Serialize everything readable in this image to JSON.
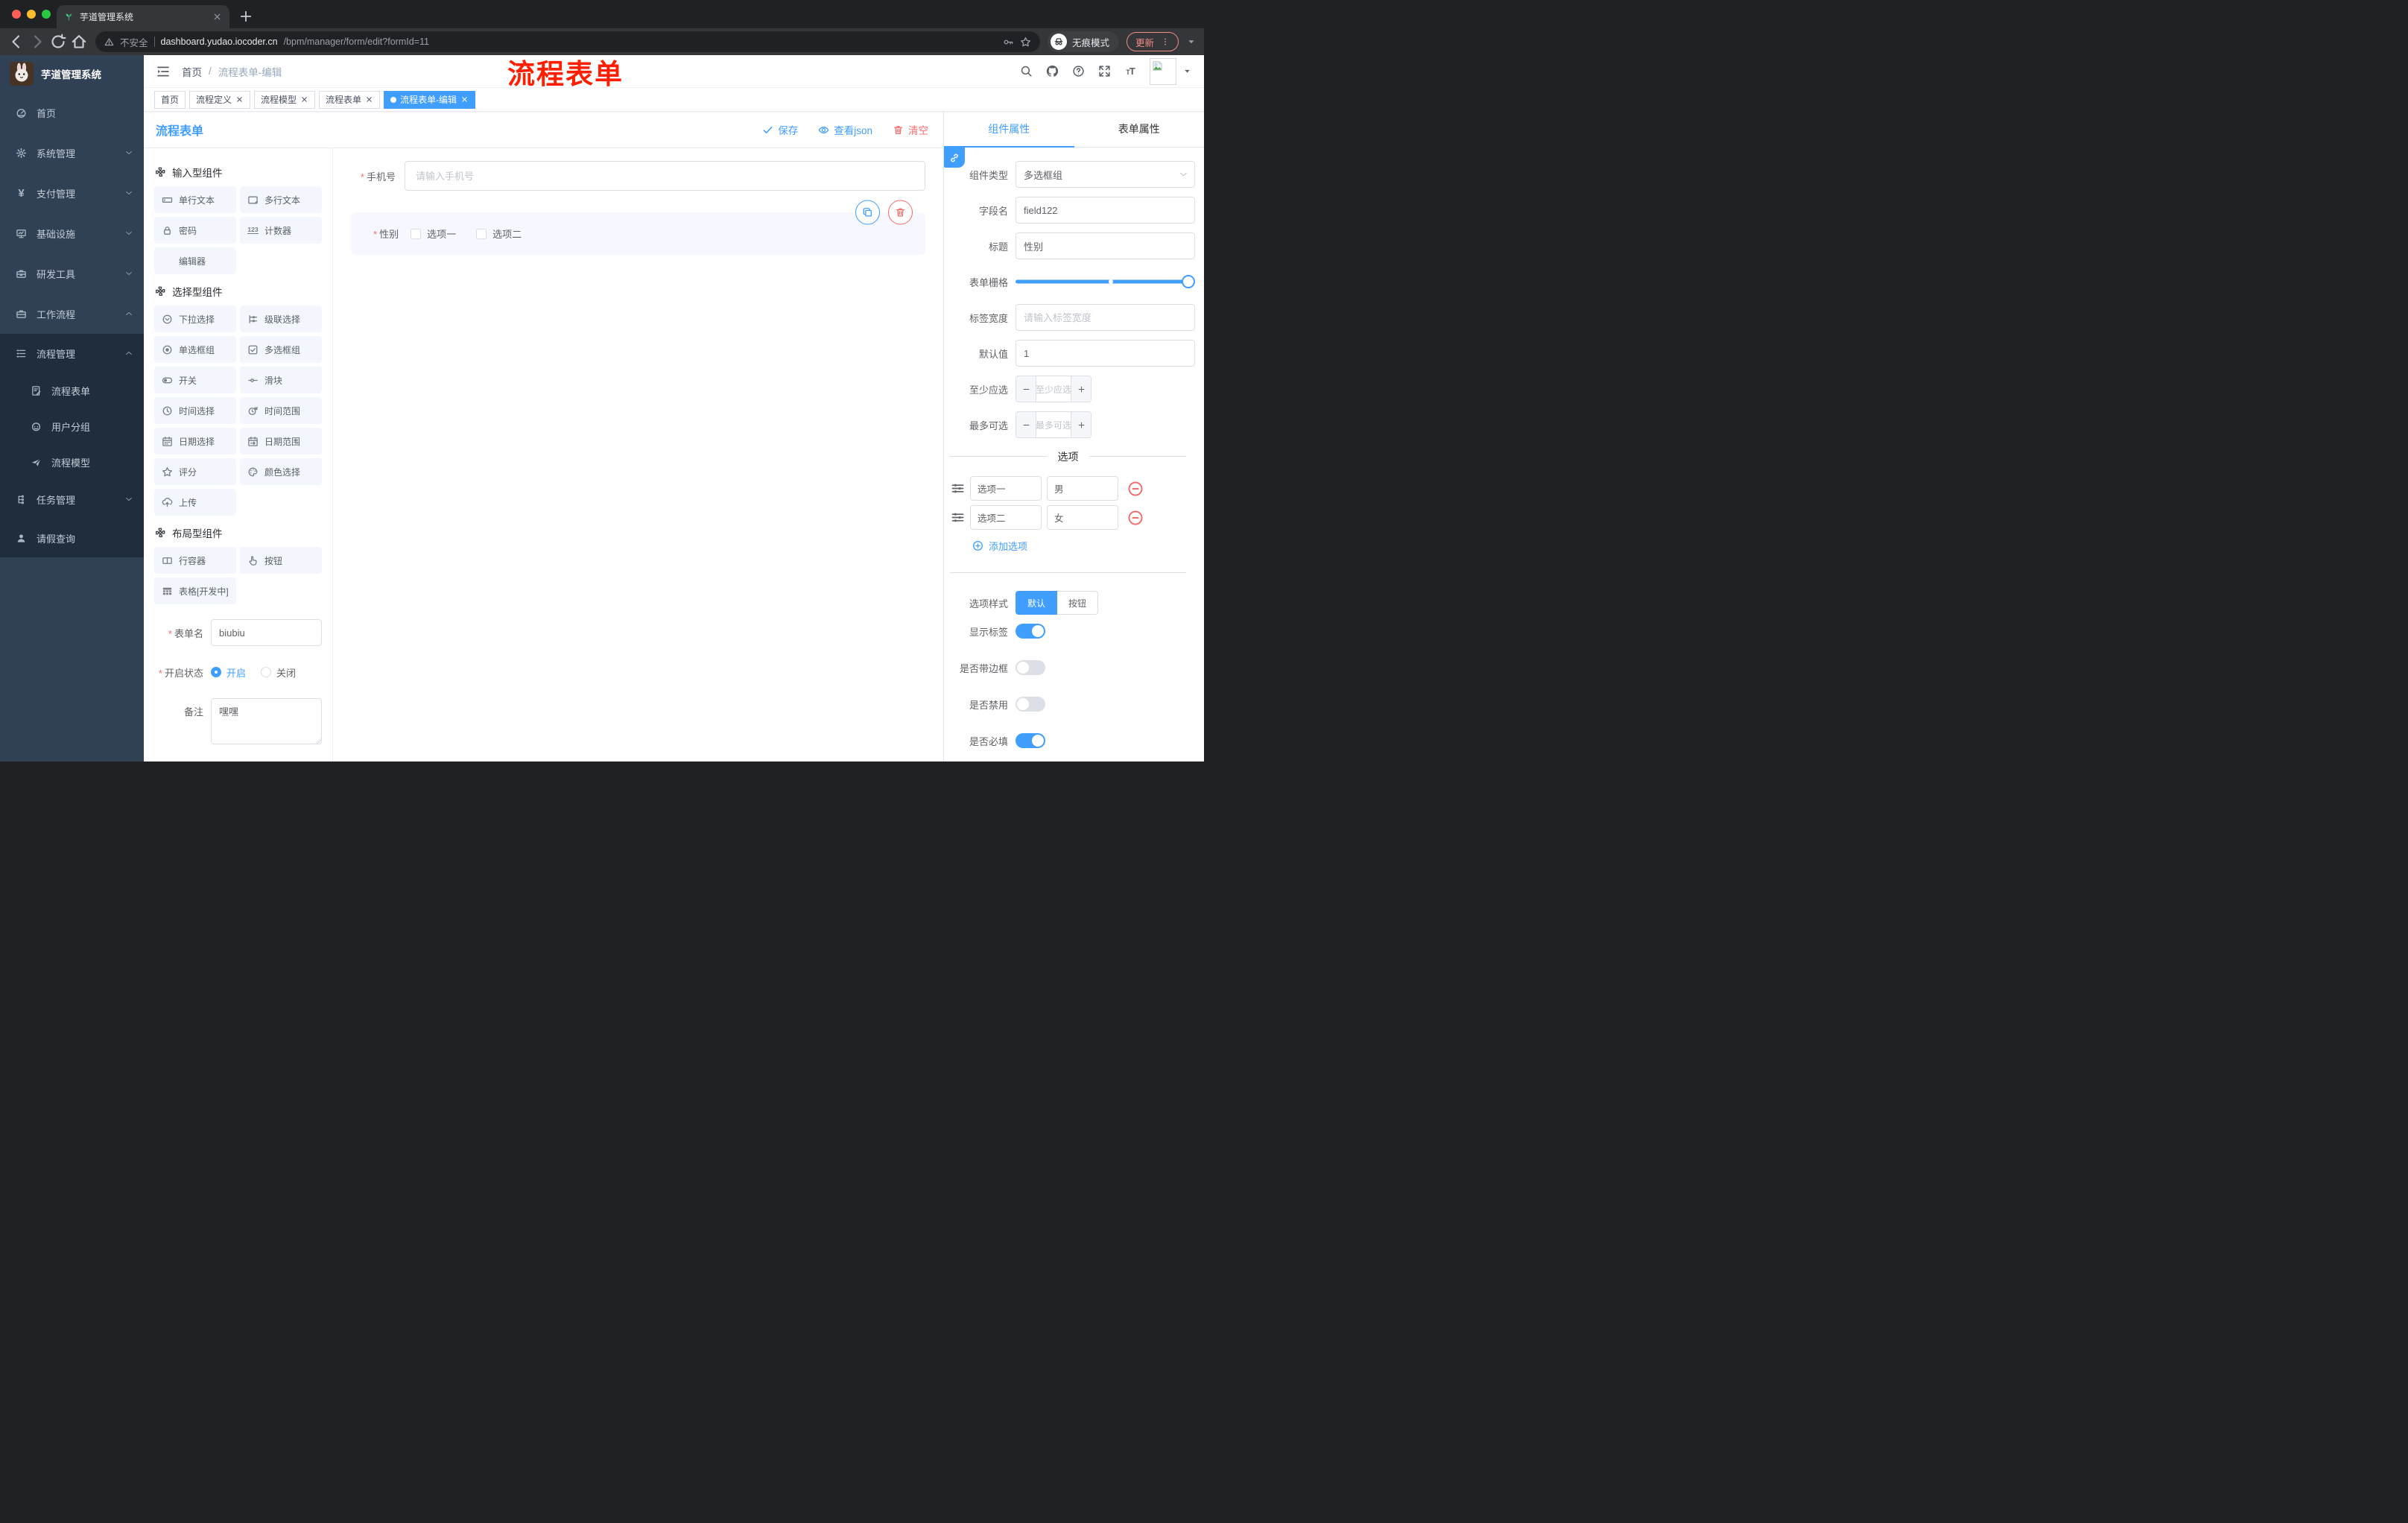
{
  "browser": {
    "tab_title": "芋道管理系统",
    "security_label": "不安全",
    "url_host": "dashboard.yudao.iocoder.cn",
    "url_path": "/bpm/manager/form/edit?formId=11",
    "incognito_label": "无痕模式",
    "update_label": "更新"
  },
  "annotation": {
    "text": "流程表单",
    "color": "#ff1e00"
  },
  "sidebar": {
    "app_title": "芋道管理系统",
    "items": [
      {
        "key": "home",
        "label": "首页",
        "icon": "dashboard-icon",
        "level": 0,
        "submenu": false,
        "chevron": ""
      },
      {
        "key": "system",
        "label": "系统管理",
        "icon": "gear-icon",
        "level": 0,
        "submenu": false,
        "chevron": "down"
      },
      {
        "key": "pay",
        "label": "支付管理",
        "icon": "yen-icon",
        "level": 0,
        "submenu": false,
        "chevron": "down"
      },
      {
        "key": "infra",
        "label": "基础设施",
        "icon": "monitor-icon",
        "level": 0,
        "submenu": false,
        "chevron": "down"
      },
      {
        "key": "devtools",
        "label": "研发工具",
        "icon": "toolbox-icon",
        "level": 0,
        "submenu": false,
        "chevron": "down"
      },
      {
        "key": "workflow",
        "label": "工作流程",
        "icon": "briefcase-icon",
        "level": 0,
        "submenu": false,
        "chevron": "up"
      },
      {
        "key": "process-mgmt",
        "label": "流程管理",
        "icon": "list-tree-icon",
        "level": 1,
        "submenu": true,
        "chevron": "up"
      },
      {
        "key": "process-form",
        "label": "流程表单",
        "icon": "doc-edit-icon",
        "level": 2,
        "submenu": true,
        "chevron": ""
      },
      {
        "key": "user-group",
        "label": "用户分组",
        "icon": "robot-icon",
        "level": 2,
        "submenu": true,
        "chevron": ""
      },
      {
        "key": "process-model",
        "label": "流程模型",
        "icon": "paper-plane-icon",
        "level": 2,
        "submenu": true,
        "chevron": ""
      },
      {
        "key": "task-mgmt",
        "label": "任务管理",
        "icon": "tree-icon",
        "level": 1,
        "submenu": true,
        "chevron": "down"
      },
      {
        "key": "leave-query",
        "label": "请假查询",
        "icon": "user-icon",
        "level": 1,
        "submenu": true,
        "chevron": ""
      }
    ]
  },
  "header": {
    "breadcrumb_home": "首页",
    "breadcrumb_sep": "/",
    "breadcrumb_current": "流程表单-编辑",
    "icons": [
      "search-icon",
      "github-icon",
      "help-icon",
      "fullscreen-icon",
      "font-size-icon"
    ]
  },
  "tags": [
    {
      "key": "home",
      "label": "首页",
      "closable": false,
      "active": false
    },
    {
      "key": "process-def",
      "label": "流程定义",
      "closable": true,
      "active": false
    },
    {
      "key": "process-model",
      "label": "流程模型",
      "closable": true,
      "active": false
    },
    {
      "key": "process-form",
      "label": "流程表单",
      "closable": true,
      "active": false
    },
    {
      "key": "process-form-edit",
      "label": "流程表单-编辑",
      "closable": true,
      "active": true
    }
  ],
  "designer": {
    "page_title": "流程表单",
    "toolbar": {
      "save": "保存",
      "view_json": "查看json",
      "clear": "清空"
    },
    "palette": {
      "sections": [
        {
          "key": "input",
          "title": "输入型组件",
          "icon": "puzzle-icon",
          "items": [
            {
              "key": "single-text",
              "label": "单行文本",
              "icon": "input-icon"
            },
            {
              "key": "multi-text",
              "label": "多行文本",
              "icon": "textarea-icon"
            },
            {
              "key": "password",
              "label": "密码",
              "icon": "lock-icon"
            },
            {
              "key": "counter",
              "label": "计数器",
              "icon": "counter-icon"
            },
            {
              "key": "editor",
              "label": "编辑器",
              "icon": ""
            }
          ]
        },
        {
          "key": "select",
          "title": "选择型组件",
          "icon": "puzzle-icon",
          "items": [
            {
              "key": "dropdown",
              "label": "下拉选择",
              "icon": "select-icon"
            },
            {
              "key": "cascader",
              "label": "级联选择",
              "icon": "cascade-icon"
            },
            {
              "key": "radio-group",
              "label": "单选框组",
              "icon": "radio-icon"
            },
            {
              "key": "checkbox-group",
              "label": "多选框组",
              "icon": "checkbox-icon"
            },
            {
              "key": "switch",
              "label": "开关",
              "icon": "switch-icon"
            },
            {
              "key": "slider",
              "label": "滑块",
              "icon": "slider-icon"
            },
            {
              "key": "time-picker",
              "label": "时间选择",
              "icon": "time-icon"
            },
            {
              "key": "time-range",
              "label": "时间范围",
              "icon": "time-range-icon"
            },
            {
              "key": "date-picker",
              "label": "日期选择",
              "icon": "date-icon"
            },
            {
              "key": "date-range",
              "label": "日期范围",
              "icon": "date-range-icon"
            },
            {
              "key": "rate",
              "label": "评分",
              "icon": "star-icon"
            },
            {
              "key": "color-picker",
              "label": "颜色选择",
              "icon": "color-icon"
            },
            {
              "key": "upload",
              "label": "上传",
              "icon": "upload-icon"
            }
          ]
        },
        {
          "key": "layout",
          "title": "布局型组件",
          "icon": "puzzle-icon",
          "items": [
            {
              "key": "row",
              "label": "行容器",
              "icon": "columns-icon"
            },
            {
              "key": "button",
              "label": "按钮",
              "icon": "pointer-icon"
            },
            {
              "key": "table",
              "label": "表格[开发中]",
              "icon": "table-icon"
            }
          ]
        }
      ]
    },
    "meta_form": {
      "form_name_label": "表单名",
      "form_name_value": "biubiu",
      "status_label": "开启状态",
      "status_options": [
        {
          "key": "on",
          "label": "开启",
          "selected": true
        },
        {
          "key": "off",
          "label": "关闭",
          "selected": false
        }
      ],
      "remark_label": "备注",
      "remark_value": "嘿嘿"
    },
    "canvas": {
      "phone_field": {
        "label": "手机号",
        "required": true,
        "placeholder": "请输入手机号",
        "value": ""
      },
      "gender_field": {
        "label": "性别",
        "required": true,
        "options": [
          {
            "key": "opt1",
            "label": "选项一",
            "checked": false
          },
          {
            "key": "opt2",
            "label": "选项二",
            "checked": false
          }
        ]
      }
    },
    "properties": {
      "tabs": [
        {
          "key": "component",
          "label": "组件属性",
          "active": true
        },
        {
          "key": "form",
          "label": "表单属性",
          "active": false
        }
      ],
      "fields": {
        "component_type": {
          "label": "组件类型",
          "value": "多选框组"
        },
        "field_name": {
          "label": "字段名",
          "value": "field122"
        },
        "title": {
          "label": "标题",
          "value": "性别"
        },
        "form_grid": {
          "label": "表单栅格",
          "stop_percent": 53,
          "handle_percent": 100
        },
        "label_width": {
          "label": "标签宽度",
          "placeholder": "请输入标签宽度",
          "value": ""
        },
        "default_value": {
          "label": "默认值",
          "value": "1"
        },
        "min_select": {
          "label": "至少应选",
          "placeholder": "至少应选"
        },
        "max_select": {
          "label": "最多可选",
          "placeholder": "最多可选"
        }
      },
      "options_section": {
        "title": "选项",
        "rows": [
          {
            "key": "row1",
            "label": "选项一",
            "value": "男"
          },
          {
            "key": "row2",
            "label": "选项二",
            "value": "女"
          }
        ],
        "add_label": "添加选项"
      },
      "style_section": {
        "option_style_label": "选项样式",
        "option_style_values": [
          {
            "key": "default",
            "label": "默认",
            "active": true
          },
          {
            "key": "button",
            "label": "按钮",
            "active": false
          }
        ],
        "toggles": [
          {
            "key": "show-label",
            "label": "显示标签",
            "on": true
          },
          {
            "key": "with-border",
            "label": "是否带边框",
            "on": false
          },
          {
            "key": "disabled",
            "label": "是否禁用",
            "on": false
          },
          {
            "key": "required",
            "label": "是否必填",
            "on": true
          }
        ]
      }
    },
    "colors": {
      "primary": "#409EFF",
      "danger": "#F56C6C",
      "sidebar": "#304156",
      "submenu": "#1f2d3d"
    }
  }
}
